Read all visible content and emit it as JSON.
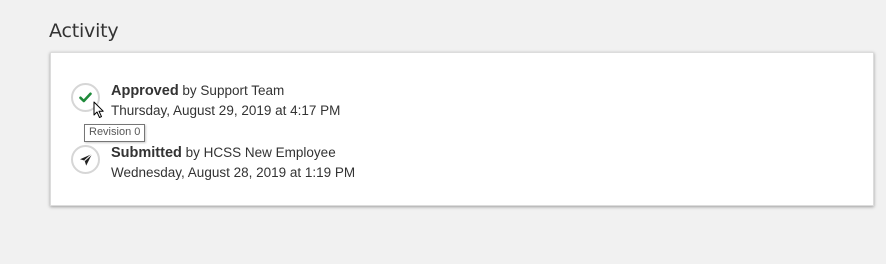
{
  "section": {
    "title": "Activity"
  },
  "activities": [
    {
      "status": "Approved",
      "by_text": " by Support Team",
      "timestamp": "Thursday, August 29, 2019 at 4:17 PM",
      "icon": "checkmark-icon",
      "icon_color": "#1e8a3a"
    },
    {
      "status": "Submitted",
      "by_text": " by HCSS New Employee",
      "timestamp": "Wednesday, August 28, 2019 at 1:19 PM",
      "icon": "paper-plane-icon",
      "icon_color": "#222222"
    }
  ],
  "tooltip": {
    "text": "Revision 0"
  }
}
